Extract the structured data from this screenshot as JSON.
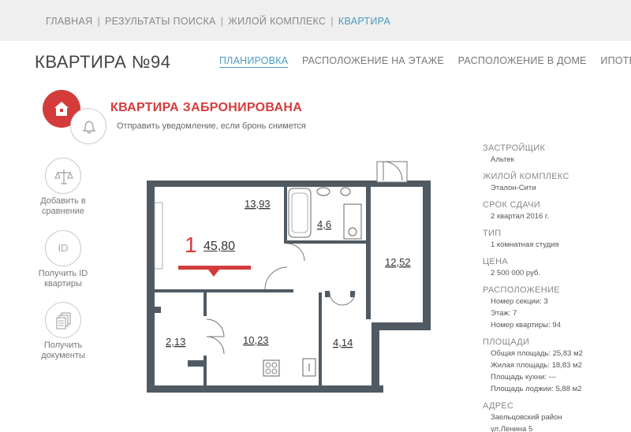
{
  "breadcrumb": {
    "items": [
      "ГЛАВНАЯ",
      "РЕЗУЛЬТАТЫ ПОИСКА",
      "ЖИЛОЙ КОМПЛЕКС"
    ],
    "current": "КВАРТИРА",
    "separator": "|"
  },
  "page_title": "КВАРТИРА №94",
  "tabs": [
    {
      "label": "ПЛАНИРОВКА",
      "active": true
    },
    {
      "label": "РАСПОЛОЖЕНИЕ НА ЭТАЖЕ",
      "active": false
    },
    {
      "label": "РАСПОЛОЖЕНИЕ В ДОМЕ",
      "active": false
    },
    {
      "label": "ИПОТЕКА",
      "active": false
    }
  ],
  "status": {
    "title": "КВАРТИРА ЗАБРОНИРОВАНА",
    "notify_text": "Отправить уведомление, если бронь снимется"
  },
  "actions": {
    "compare": "Добавить в сравнение",
    "get_id": "Получить ID квартиры",
    "id_glyph": "ID",
    "documents": "Получить документы"
  },
  "plan": {
    "rooms_count": "1",
    "total_area": "45,80",
    "room_areas": {
      "living": "13,93",
      "bath": "4,6",
      "hall": "12,52",
      "loggia": "2,13",
      "kitchen": "10,23",
      "storage": "4,14"
    }
  },
  "info": {
    "developer_label": "ЗАСТРОЙЩИК",
    "developer": "Альтек",
    "complex_label": "ЖИЛОЙ КОМПЛЕКС",
    "complex": "Эталон-Сити",
    "deadline_label": "СРОК СДАЧИ",
    "deadline": "2 квартал 2016 г.",
    "type_label": "ТИП",
    "type": "1 комнатная студия",
    "price_label": "ЦЕНА",
    "price": "2 500 000 руб.",
    "location_label": "РАСПОЛОЖЕНИЕ",
    "section": "Номер секции: 3",
    "floor": "Этаж: 7",
    "number": "Номер квартиры: 94",
    "areas_label": "ПЛОЩАДИ",
    "total_area": "Общая площадь: 25,83 м2",
    "living_area": "Жилая площадь: 18,83 м2",
    "kitchen_area": "Площадь кухни: ---",
    "loggia_area": "Площадь лоджии: 5,88 м2",
    "address_label": "АДРЕС",
    "district": "Заельцовский район",
    "street": "ул.Ленина 5"
  },
  "colors": {
    "accent": "#d43c3c",
    "link": "#4a9bbd",
    "wall": "#4f5a63"
  }
}
